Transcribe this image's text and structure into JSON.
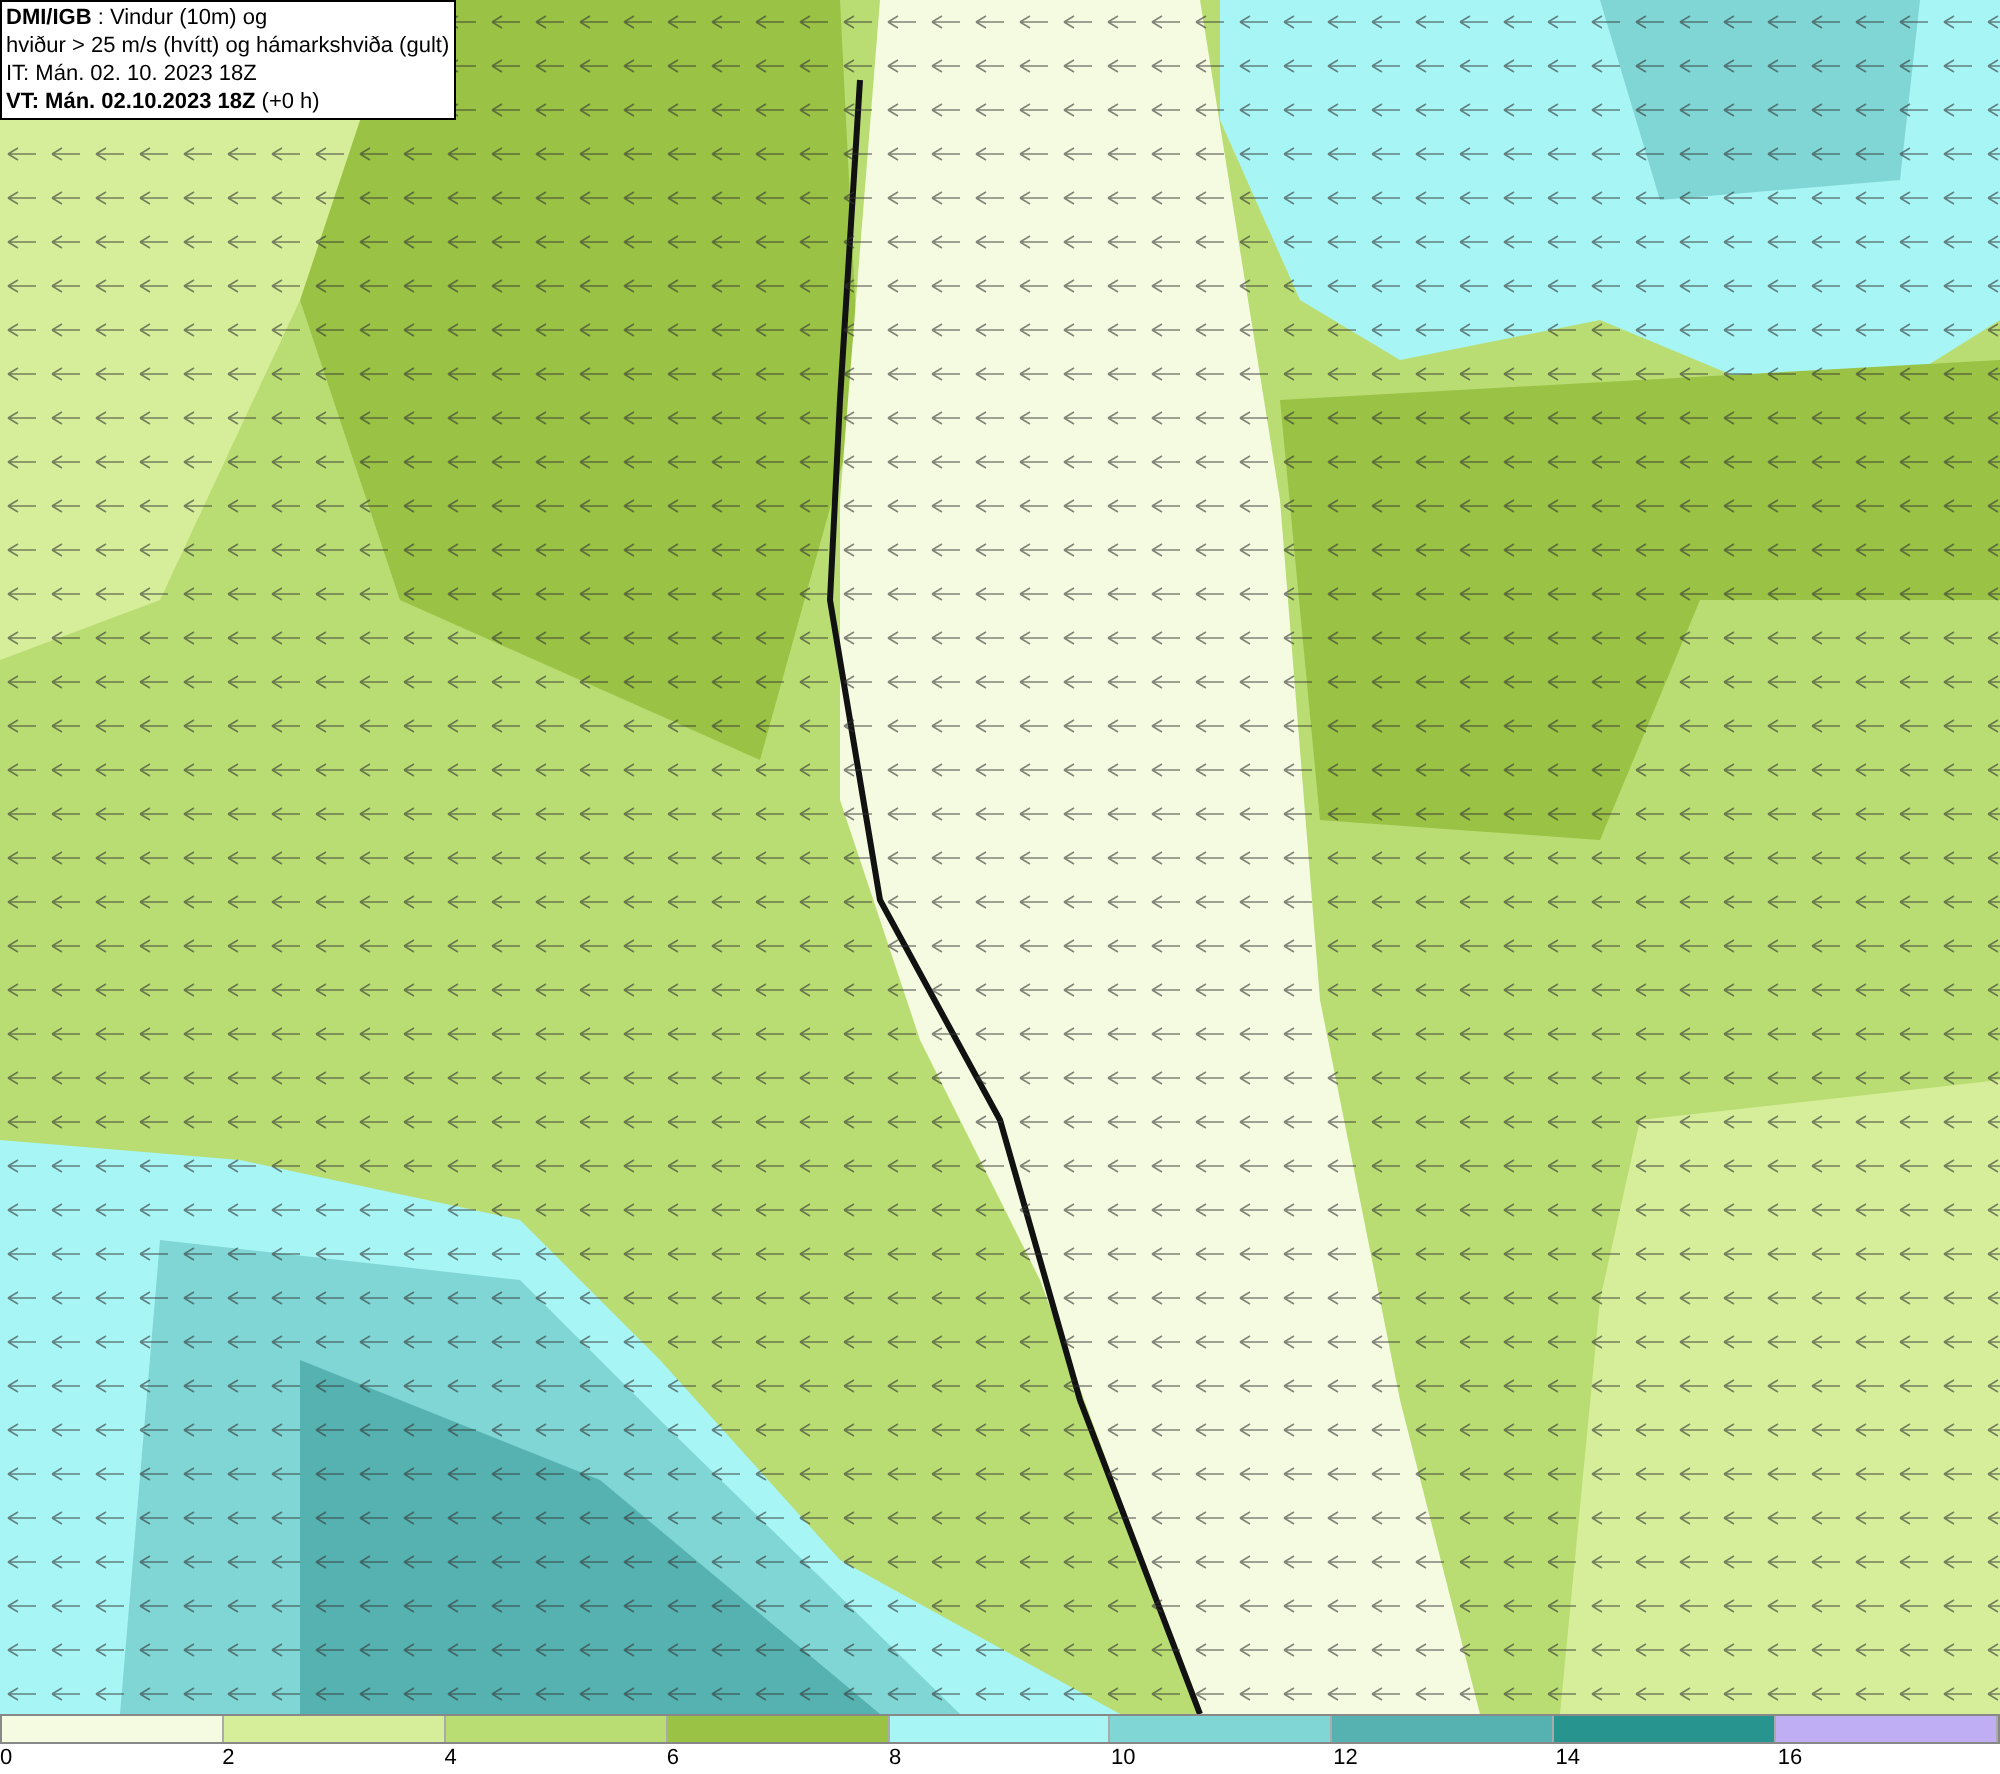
{
  "info_box": {
    "lines": [
      "**DMI/IGB** : Vindur (10m) og",
      "hviður > 25 m/s (hvítt) og hámarkshviða (gult)",
      "IT: Mán. 02. 10. 2023 18Z",
      "**VT: Mán. 02.10.2023 18Z** (+0 h)"
    ]
  },
  "legend": {
    "bins": [
      {
        "color": "#f5fbe0"
      },
      {
        "color": "#d6ee9a"
      },
      {
        "color": "#b9dd72"
      },
      {
        "color": "#9ac244"
      },
      {
        "color": "#a8f5f5"
      },
      {
        "color": "#7fd6d4"
      },
      {
        "color": "#56b2b0"
      },
      {
        "color": "#279490"
      },
      {
        "color": "#c0aef5"
      }
    ],
    "ticks": [
      "0",
      "2",
      "4",
      "6",
      "8",
      "10",
      "12",
      "14",
      "16"
    ]
  }
}
